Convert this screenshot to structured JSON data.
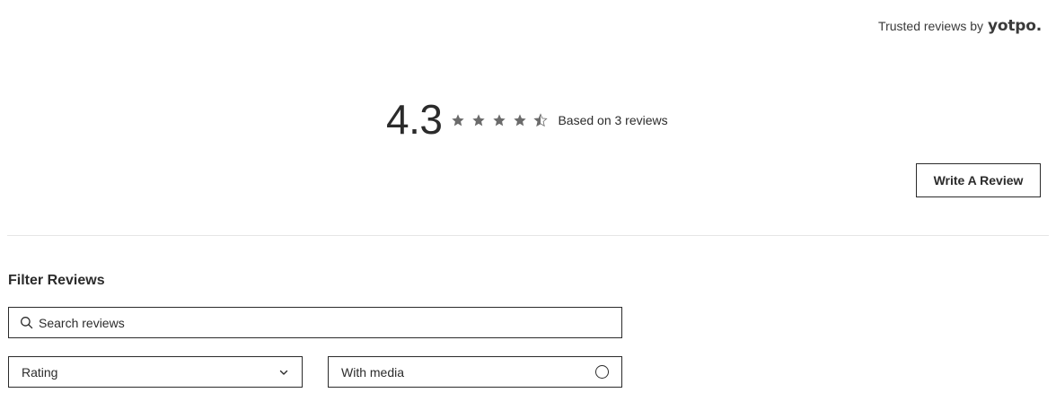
{
  "header": {
    "trusted_text": "Trusted reviews by",
    "brand": "yotpo."
  },
  "summary": {
    "average_score": "4.3",
    "rating_value": 4.3,
    "rating_max": 5,
    "based_on": "Based on 3 reviews",
    "star_color": "#6b6b6b"
  },
  "actions": {
    "write_review_label": "Write A Review"
  },
  "filters": {
    "title": "Filter Reviews",
    "search_placeholder": "Search reviews",
    "rating_select_value": "Rating",
    "media_toggle_label": "With media",
    "media_selected": false
  },
  "icons": {
    "search": "search-icon",
    "chevron": "chevron-down-icon",
    "star": "star-icon",
    "half_star": "half-star-icon"
  }
}
